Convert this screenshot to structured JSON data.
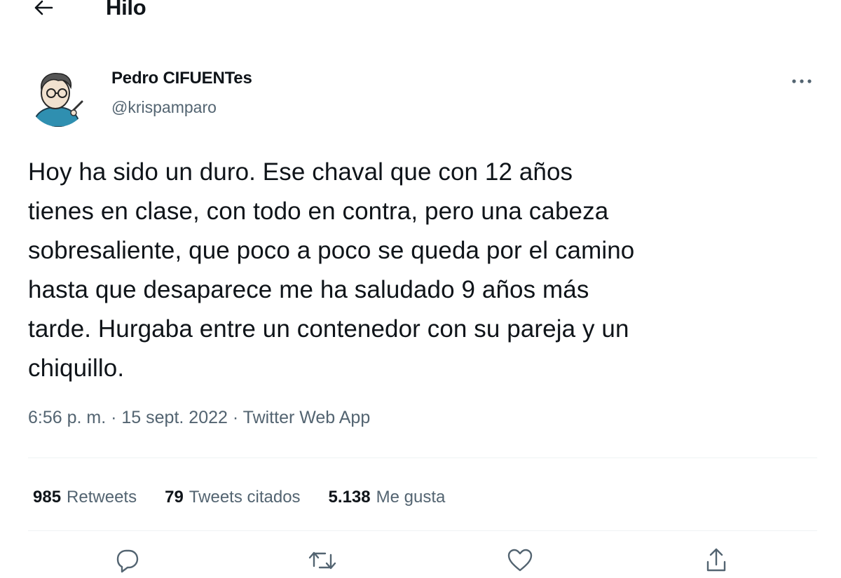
{
  "header": {
    "title": "Hilo",
    "back_icon": "arrow-left-icon"
  },
  "tweet": {
    "author": {
      "display_name": "Pedro CIFUENTes",
      "handle": "@krispamparo"
    },
    "text": "Hoy ha sido un duro. Ese chaval que con 12 años\ntienes en clase, con todo en contra, pero una cabeza\nsobresaliente, que poco a poco se queda por el camino\nhasta que desaparece me ha saludado 9 años más\ntarde. Hurgaba entre un contenedor con su pareja y un\nchiquillo.",
    "meta": {
      "time": "6:56 p. m.",
      "sep1": " · ",
      "date": "15 sept. 2022",
      "sep2": " · ",
      "source": "Twitter Web App"
    },
    "stats": [
      {
        "count": "985",
        "label": "Retweets"
      },
      {
        "count": "79",
        "label": "Tweets citados"
      },
      {
        "count": "5.138",
        "label": "Me gusta"
      }
    ],
    "actions": [
      "reply-icon",
      "retweet-icon",
      "like-icon",
      "share-icon"
    ]
  },
  "colors": {
    "text": "#0f1419",
    "secondary": "#536471",
    "divider": "#eff3f4"
  }
}
